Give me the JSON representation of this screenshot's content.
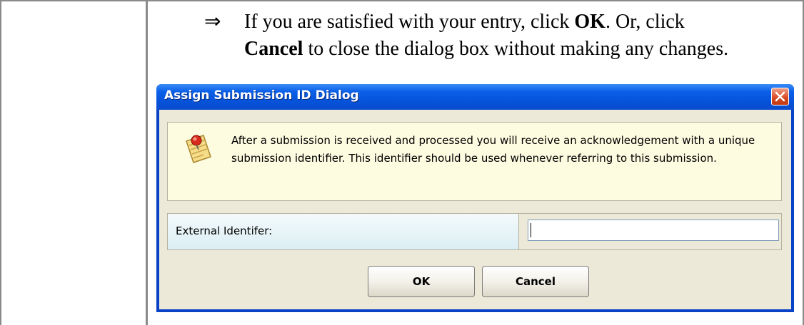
{
  "instruction": {
    "arrow": "⇒",
    "line1_prefix": "If you are satisfied with your entry, click ",
    "line1_bold": "OK",
    "line1_suffix": ". Or, click",
    "line2_bold": "Cancel",
    "line2_suffix": " to close the dialog box without making any changes."
  },
  "dialog": {
    "title": "Assign Submission ID Dialog",
    "close_icon": "close-x-icon",
    "info_icon": "note-pin-icon",
    "info_text": "After a submission is received and processed you will receive an acknowledgement with a unique submission identifier. This identifier should be used whenever referring to this submission.",
    "field_label": "External Identifer:",
    "field_value": "",
    "ok_label": "OK",
    "cancel_label": "Cancel",
    "colors": {
      "titlebar": "#0a5fe8",
      "close_button": "#d8481f",
      "info_background": "#fdfbe0",
      "label_cell": "#dbeef4",
      "client": "#ece9d8"
    }
  }
}
